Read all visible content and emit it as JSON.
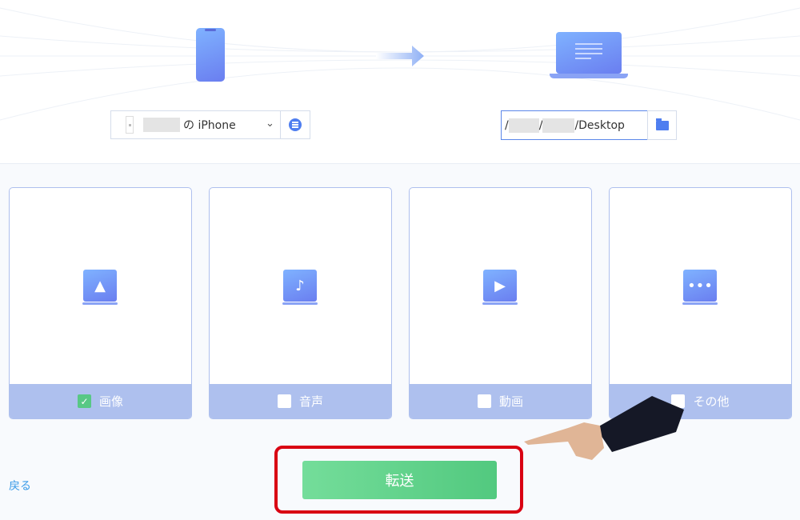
{
  "source": {
    "device_name_suffix": "の iPhone",
    "icon": "iphone-icon",
    "menu_icon": "list-icon"
  },
  "target": {
    "path": "/",
    "path_mid": "/",
    "path_end": "/Desktop",
    "folder_icon": "folder-icon"
  },
  "categories": [
    {
      "label": "画像",
      "icon": "image-icon",
      "checked": true
    },
    {
      "label": "音声",
      "icon": "music-icon",
      "checked": false
    },
    {
      "label": "動画",
      "icon": "video-icon",
      "checked": false
    },
    {
      "label": "その他",
      "icon": "more-icon",
      "checked": false
    }
  ],
  "footer": {
    "back_label": "戻る",
    "transfer_label": "転送"
  },
  "colors": {
    "accent": "#4f7ef0",
    "card_footer": "#aec0ee",
    "transfer": "#5fd28a",
    "highlight": "#d90012",
    "link": "#3a9be8"
  }
}
